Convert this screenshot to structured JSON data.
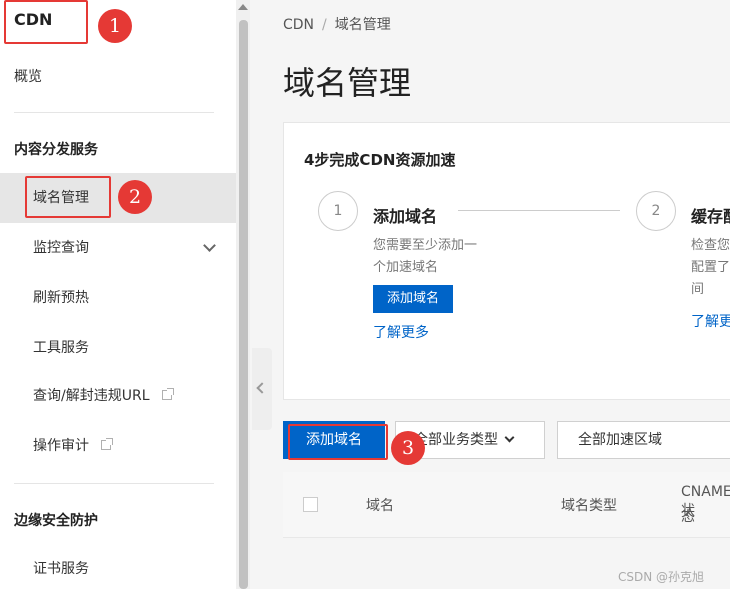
{
  "sidebar": {
    "title": "CDN",
    "overview": "概览",
    "group1": "内容分发服务",
    "items": [
      {
        "label": "域名管理"
      },
      {
        "label": "监控查询"
      },
      {
        "label": "刷新预热"
      },
      {
        "label": "工具服务"
      },
      {
        "label": "查询/解封违规URL"
      },
      {
        "label": "操作审计"
      }
    ],
    "group2": "边缘安全防护",
    "cert": "证书服务"
  },
  "breadcrumb": {
    "root": "CDN",
    "sep": "/",
    "current": "域名管理"
  },
  "page_title": "域名管理",
  "guide": {
    "title": "4步完成CDN资源加速",
    "step1": {
      "num": "1",
      "title": "添加域名",
      "desc_line1": "您需要至少添加一",
      "desc_line2": "个加速域名",
      "button": "添加域名",
      "link": "了解更多"
    },
    "step2": {
      "num": "2",
      "title": "缓存配",
      "desc_line1": "检查您",
      "desc_line2": "配置了",
      "desc_line3": "间",
      "link": "了解更"
    }
  },
  "toolbar": {
    "add_button": "添加域名",
    "business_type": "全部业务类型",
    "region": "全部加速区域"
  },
  "table": {
    "columns": [
      "域名",
      "域名类型",
      "CNAME状",
      "态"
    ]
  },
  "annotations": [
    "1",
    "2",
    "3"
  ],
  "watermark": "CSDN @孙克旭",
  "colors": {
    "primary": "#0064c8",
    "annotation": "#e53935"
  }
}
